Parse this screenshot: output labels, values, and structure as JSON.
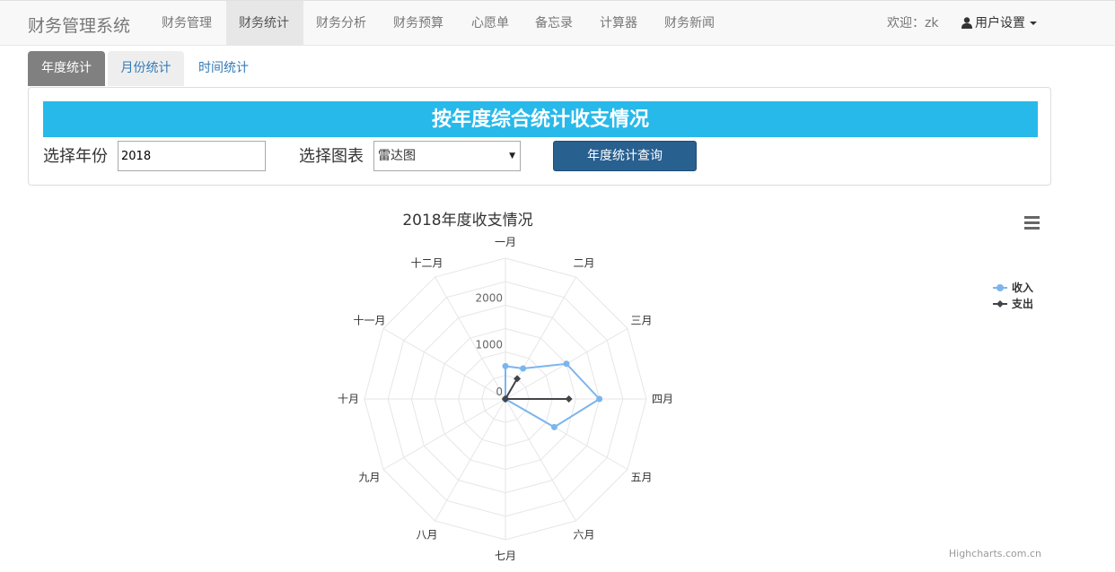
{
  "navbar": {
    "brand": "财务管理系统",
    "items": [
      "财务管理",
      "财务统计",
      "财务分析",
      "财务预算",
      "心愿单",
      "备忘录",
      "计算器",
      "财务新闻"
    ],
    "welcome": "欢迎：zk",
    "user_menu": "用户设置"
  },
  "tabs": [
    "年度统计",
    "月份统计",
    "时间统计"
  ],
  "panel": {
    "banner": "按年度综合统计收支情况",
    "year_label": "选择年份",
    "year_value": "2018",
    "chart_label": "选择图表",
    "chart_value": "雷达图",
    "query_button": "年度统计查询"
  },
  "icons": {
    "user": "person-icon",
    "chart_menu": "hamburger-menu-icon"
  },
  "chart_data": {
    "type": "radar",
    "title": "2018年度收支情况",
    "categories": [
      "一月",
      "二月",
      "三月",
      "四月",
      "五月",
      "六月",
      "七月",
      "八月",
      "九月",
      "十月",
      "十一月",
      "十二月"
    ],
    "ylim": [
      0,
      3000
    ],
    "ticks": [
      0,
      1000,
      2000
    ],
    "series": [
      {
        "name": "收入",
        "color": "#7cb5ec",
        "marker": "circle",
        "values": [
          700,
          750,
          1500,
          2000,
          1200,
          0,
          0,
          0,
          0,
          0,
          0,
          0
        ]
      },
      {
        "name": "支出",
        "color": "#434348",
        "marker": "diamond",
        "values": [
          0,
          500,
          0,
          1350,
          0,
          0,
          0,
          0,
          0,
          0,
          0,
          0
        ]
      }
    ],
    "legend_position": "right",
    "credit": "Highcharts.com.cn"
  }
}
